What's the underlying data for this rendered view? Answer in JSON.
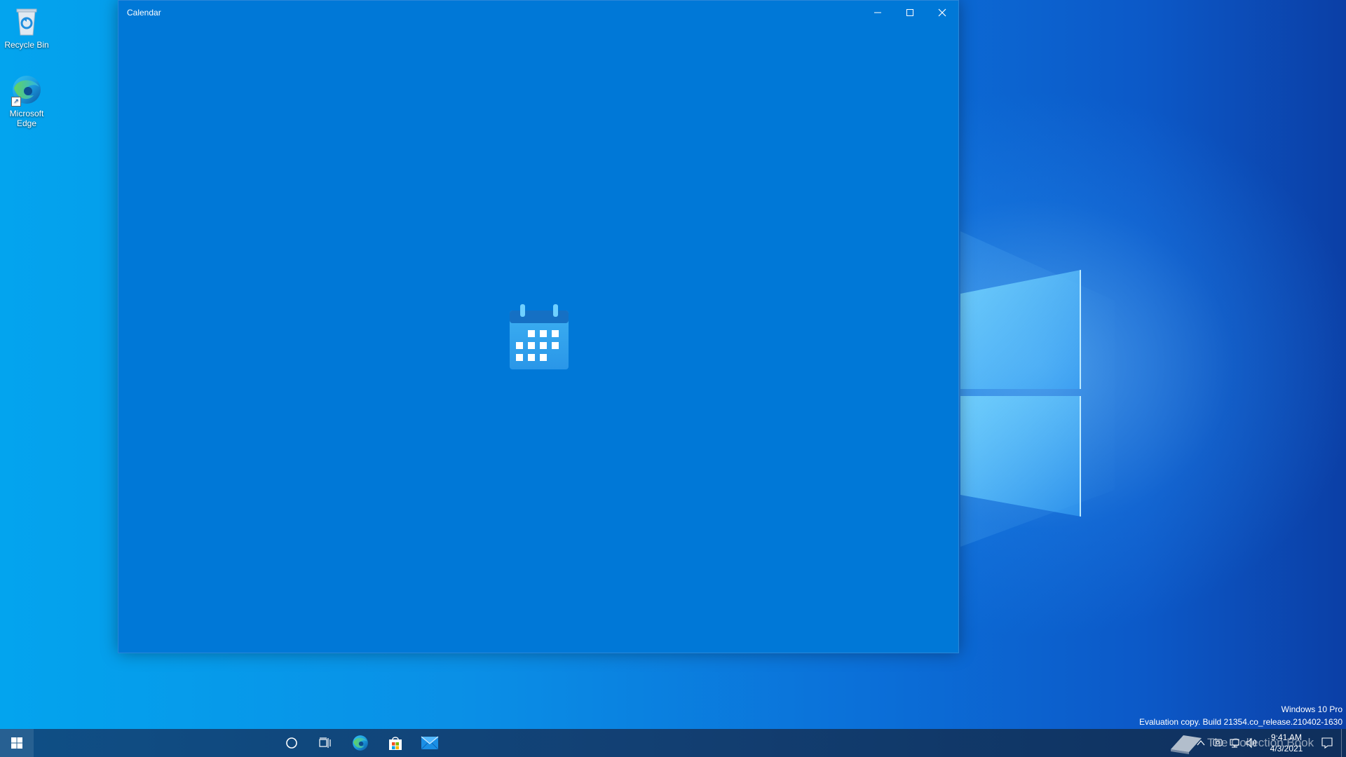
{
  "desktop": {
    "icons": [
      {
        "label": "Recycle Bin",
        "icon": "recycle-bin-icon"
      },
      {
        "label": "Microsoft Edge",
        "icon": "edge-icon"
      }
    ],
    "watermark": {
      "line1": "Windows 10 Pro",
      "line2": "Evaluation copy. Build 21354.co_release.210402-1630"
    }
  },
  "window": {
    "title": "Calendar",
    "background_color": "#0078d7",
    "splash_icon": "calendar-icon",
    "buttons": {
      "minimize": "minimize-icon",
      "maximize": "maximize-icon",
      "close": "close-icon"
    }
  },
  "taskbar": {
    "pinned": [
      {
        "name": "search",
        "icon": "cortana-circle-icon"
      },
      {
        "name": "task-view",
        "icon": "task-view-icon"
      },
      {
        "name": "microsoft-edge",
        "icon": "edge-icon"
      },
      {
        "name": "microsoft-store",
        "icon": "store-bag-icon"
      },
      {
        "name": "mail",
        "icon": "mail-envelope-icon"
      }
    ],
    "tray_overlay_text": "The Collection Book",
    "clock": {
      "time": "9:41 AM",
      "date": "4/3/2021"
    },
    "tray_icons": [
      "chevron-up-icon",
      "meet-now-icon",
      "network-icon",
      "volume-icon"
    ],
    "notification_icon": "action-center-icon"
  }
}
